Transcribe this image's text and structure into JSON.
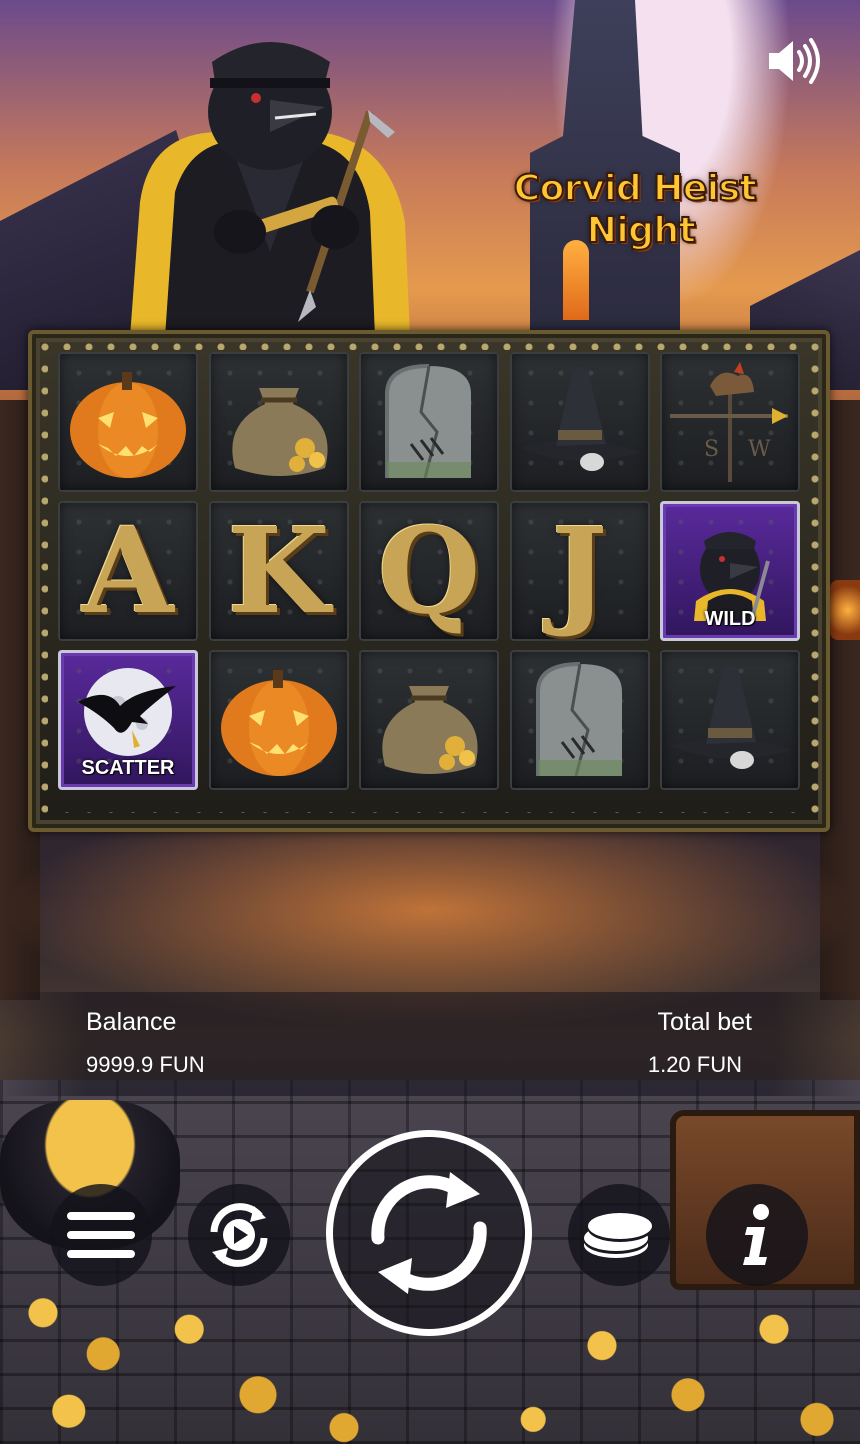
{
  "game": {
    "title_line1": "Corvid Heist",
    "title_line2": "Night"
  },
  "reels": {
    "rows": [
      [
        "pumpkin",
        "loot-sack",
        "gravestone",
        "witch-hat",
        "weathervane"
      ],
      [
        "letter-a",
        "letter-k",
        "letter-q",
        "letter-j",
        "wild"
      ],
      [
        "scatter",
        "pumpkin",
        "loot-sack",
        "gravestone",
        "witch-hat"
      ]
    ],
    "letters": {
      "letter-a": "A",
      "letter-k": "K",
      "letter-q": "Q",
      "letter-j": "J"
    },
    "wild_label": "WILD",
    "scatter_label": "SCATTER"
  },
  "info": {
    "balance_label": "Balance",
    "balance_value": "9999.9 FUN",
    "total_bet_label": "Total bet",
    "total_bet_value": "1.20 FUN"
  },
  "icons": {
    "sound": "speaker-icon",
    "menu": "hamburger-menu-icon",
    "autoplay": "autoplay-icon",
    "spin": "spin-arrows-icon",
    "bet": "coin-stack-icon",
    "info": "info-icon"
  },
  "colors": {
    "logo_gold": "#ffc634",
    "special_purple": "#5a2a9c"
  }
}
